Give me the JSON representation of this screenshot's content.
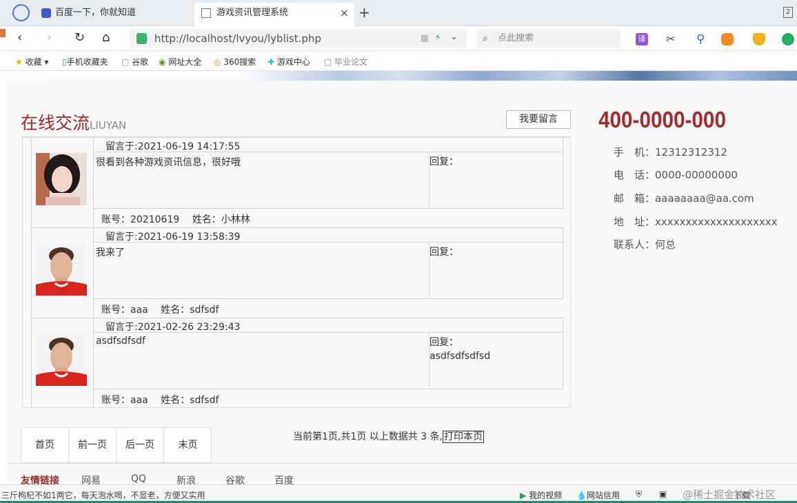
{
  "tabs": [
    {
      "title": "百度一下，你就知道",
      "icon": "baidu-paw-icon"
    },
    {
      "title": "游戏资讯管理系统",
      "icon": "page-icon",
      "active": true
    }
  ],
  "tab_count": "2",
  "new_tab": "+",
  "address": {
    "url": "http://localhost/lvyou/lyblist.php",
    "search_placeholder": "点此搜索"
  },
  "nav": {
    "back": "‹",
    "forward": "›",
    "reload": "↻",
    "home": "⌂"
  },
  "toolbar": {
    "translate": "译"
  },
  "bookmarks": [
    {
      "label": "收藏",
      "icon": "star-icon"
    },
    {
      "label": "手机收藏夹",
      "icon": "phone-icon"
    },
    {
      "label": "谷歌",
      "icon": "page-icon"
    },
    {
      "label": "网址大全",
      "icon": "globe-icon"
    },
    {
      "label": "360搜索",
      "icon": "search-360-icon"
    },
    {
      "label": "游戏中心",
      "icon": "game-icon"
    },
    {
      "label": "毕业论文",
      "icon": "page-icon"
    }
  ],
  "page": {
    "title": "在线交流",
    "title_sub": "LIUYAN",
    "leave_button": "我要留言",
    "messages": [
      {
        "stamp": "留言于:2021-06-19 14:17:55",
        "content": "很看到各种游戏资讯信息，很好哦",
        "reply_label": "回复：",
        "reply": "",
        "info": "账号：20210619　 姓名：小林林"
      },
      {
        "stamp": "留言于:2021-06-19 13:58:39",
        "content": "我来了",
        "reply_label": "回复：",
        "reply": "",
        "info": "账号：aaa　 姓名：sdfsdf"
      },
      {
        "stamp": "留言于:2021-02-26 23:29:43",
        "content": "asdfsdfsdf",
        "reply_label": "回复：",
        "reply": "asdfsdfsdfsd",
        "info": "账号：aaa　 姓名：sdfsdf"
      }
    ],
    "pager": {
      "first": "首页",
      "prev": "前一页",
      "next": "后一页",
      "last": "末页"
    },
    "page_info": "当前第1页,共1页 以上数据共 3 条,",
    "print_button": "打印本页"
  },
  "contact": {
    "phone": "400-0000-000",
    "mobile": "手　机：12312312312",
    "tel": "电　话：0000-00000000",
    "email": "邮　箱：aaaaaaaa@aa.com",
    "address": "地　址：xxxxxxxxxxxxxxxxxxxx",
    "person": "联系人：何总"
  },
  "footer": {
    "links_title": "友情链接",
    "links": [
      "网易",
      "QQ",
      "新浪",
      "谷歌",
      "百度"
    ]
  },
  "status": {
    "left": "三斤枸杞不如1两它，每天泡水喝，不显老，方便又实用",
    "video": "我的视频",
    "credit": "网站信用",
    "download": "下载",
    "watermark": "@稀土掘金技术社区"
  }
}
